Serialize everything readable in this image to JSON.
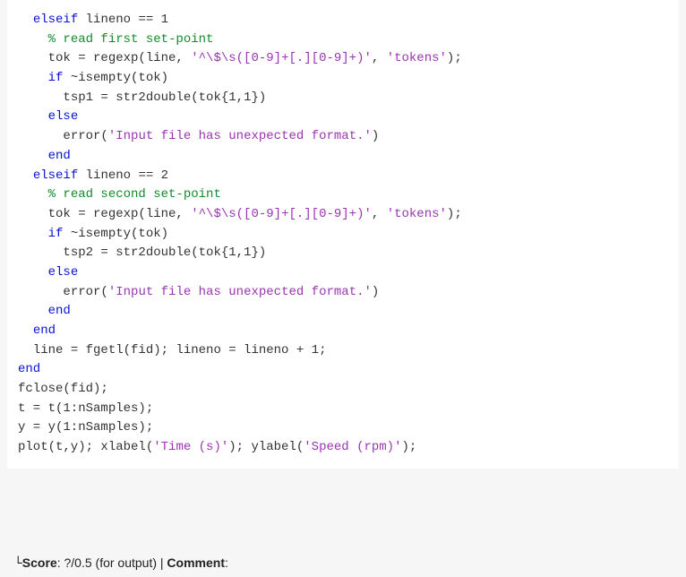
{
  "code": {
    "lines": [
      {
        "indent": "  ",
        "segs": [
          {
            "c": "kw",
            "t": "elseif"
          },
          {
            "c": "id",
            "t": " lineno == "
          },
          {
            "c": "id",
            "t": "1"
          }
        ]
      },
      {
        "indent": "    ",
        "segs": [
          {
            "c": "cm",
            "t": "% read first set-point"
          }
        ]
      },
      {
        "indent": "    ",
        "segs": [
          {
            "c": "id",
            "t": "tok = regexp(line, "
          },
          {
            "c": "st",
            "t": "'^\\$\\s([0-9]+[.][0-9]+)'"
          },
          {
            "c": "id",
            "t": ", "
          },
          {
            "c": "st",
            "t": "'tokens'"
          },
          {
            "c": "id",
            "t": ");"
          }
        ]
      },
      {
        "indent": "    ",
        "segs": [
          {
            "c": "kw",
            "t": "if"
          },
          {
            "c": "id",
            "t": " ~isempty(tok)"
          }
        ]
      },
      {
        "indent": "      ",
        "segs": [
          {
            "c": "id",
            "t": "tsp1 = str2double(tok{1,1})"
          }
        ]
      },
      {
        "indent": "    ",
        "segs": [
          {
            "c": "kw",
            "t": "else"
          }
        ]
      },
      {
        "indent": "      ",
        "segs": [
          {
            "c": "id",
            "t": "error("
          },
          {
            "c": "st",
            "t": "'Input file has unexpected format.'"
          },
          {
            "c": "id",
            "t": ")"
          }
        ]
      },
      {
        "indent": "    ",
        "segs": [
          {
            "c": "kw",
            "t": "end"
          }
        ]
      },
      {
        "indent": "  ",
        "segs": [
          {
            "c": "kw",
            "t": "elseif"
          },
          {
            "c": "id",
            "t": " lineno == "
          },
          {
            "c": "id",
            "t": "2"
          }
        ]
      },
      {
        "indent": "    ",
        "segs": [
          {
            "c": "cm",
            "t": "% read second set-point"
          }
        ]
      },
      {
        "indent": "    ",
        "segs": [
          {
            "c": "id",
            "t": "tok = regexp(line, "
          },
          {
            "c": "st",
            "t": "'^\\$\\s([0-9]+[.][0-9]+)'"
          },
          {
            "c": "id",
            "t": ", "
          },
          {
            "c": "st",
            "t": "'tokens'"
          },
          {
            "c": "id",
            "t": ");"
          }
        ]
      },
      {
        "indent": "    ",
        "segs": [
          {
            "c": "kw",
            "t": "if"
          },
          {
            "c": "id",
            "t": " ~isempty(tok)"
          }
        ]
      },
      {
        "indent": "      ",
        "segs": [
          {
            "c": "id",
            "t": "tsp2 = str2double(tok{1,1})"
          }
        ]
      },
      {
        "indent": "    ",
        "segs": [
          {
            "c": "kw",
            "t": "else"
          }
        ]
      },
      {
        "indent": "      ",
        "segs": [
          {
            "c": "id",
            "t": "error("
          },
          {
            "c": "st",
            "t": "'Input file has unexpected format.'"
          },
          {
            "c": "id",
            "t": ")"
          }
        ]
      },
      {
        "indent": "    ",
        "segs": [
          {
            "c": "kw",
            "t": "end"
          }
        ]
      },
      {
        "indent": "  ",
        "segs": [
          {
            "c": "kw",
            "t": "end"
          }
        ]
      },
      {
        "indent": "  ",
        "segs": [
          {
            "c": "id",
            "t": "line = fgetl(fid); lineno = lineno + 1;"
          }
        ]
      },
      {
        "indent": "",
        "segs": [
          {
            "c": "kw",
            "t": "end"
          }
        ]
      },
      {
        "indent": "",
        "segs": [
          {
            "c": "id",
            "t": "fclose(fid);"
          }
        ]
      },
      {
        "indent": "",
        "segs": [
          {
            "c": "id",
            "t": ""
          }
        ]
      },
      {
        "indent": "",
        "segs": [
          {
            "c": "id",
            "t": "t = t(1:nSamples);"
          }
        ]
      },
      {
        "indent": "",
        "segs": [
          {
            "c": "id",
            "t": "y = y(1:nSamples);"
          }
        ]
      },
      {
        "indent": "",
        "segs": [
          {
            "c": "id",
            "t": "plot(t,y); xlabel("
          },
          {
            "c": "st",
            "t": "'Time (s)'"
          },
          {
            "c": "id",
            "t": "); ylabel("
          },
          {
            "c": "st",
            "t": "'Speed (rpm)'"
          },
          {
            "c": "id",
            "t": ");"
          }
        ]
      }
    ]
  },
  "footer": {
    "tick": "└",
    "score_label": "Score",
    "score_value": ": ?/0.5 (for output) | ",
    "comment_label": "Comment",
    "comment_value": ":"
  }
}
